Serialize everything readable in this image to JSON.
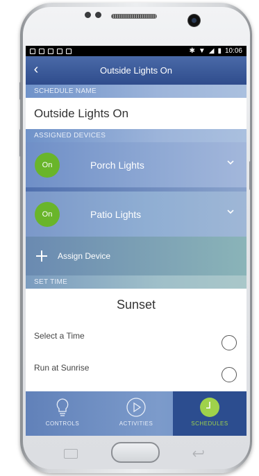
{
  "statusbar": {
    "time": "10:06"
  },
  "appbar": {
    "title": "Outside Lights On",
    "back_icon": "chevron-left-icon"
  },
  "schedule_name": {
    "section_label": "SCHEDULE NAME",
    "value": "Outside Lights On"
  },
  "devices": {
    "section_label": "ASSIGNED DEVICES",
    "items": [
      {
        "state": "On",
        "name": "Porch Lights"
      },
      {
        "state": "On",
        "name": "Patio Lights"
      }
    ],
    "assign_label": "Assign Device"
  },
  "set_time": {
    "section_label": "SET TIME",
    "selected": "Sunset",
    "options": [
      {
        "label": "Select a Time"
      },
      {
        "label": "Run at Sunrise"
      }
    ]
  },
  "tabs": [
    {
      "label": "CONTROLS",
      "icon": "lightbulb-icon",
      "active": false
    },
    {
      "label": "ACTIVITIES",
      "icon": "play-icon",
      "active": false
    },
    {
      "label": "SCHEDULES",
      "icon": "clock-icon",
      "active": true
    }
  ],
  "colors": {
    "accent_green": "#69b52a",
    "nav_active": "#2c4d8f",
    "tab_active_text": "#9fd24b"
  }
}
